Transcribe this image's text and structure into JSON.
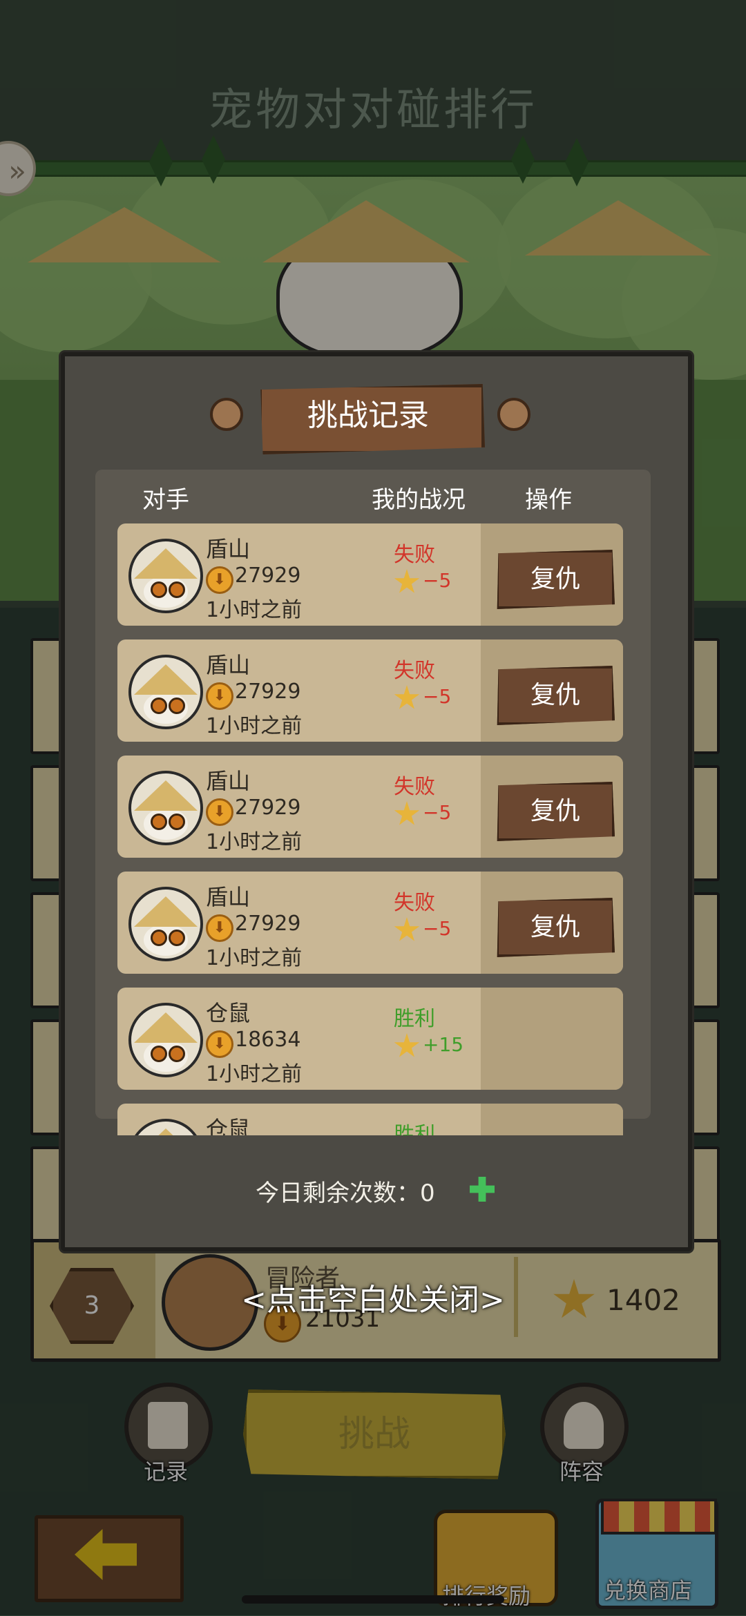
{
  "page": {
    "title": "宠物对对碰排行"
  },
  "modal": {
    "title": "挑战记录",
    "columns": {
      "opponent": "对手",
      "my_record": "我的战况",
      "action": "操作"
    },
    "rows": [
      {
        "name": "盾山",
        "score": "27929",
        "time": "1小时之前",
        "result": "失败",
        "delta": "−5",
        "action": "复仇",
        "outcome": "lose"
      },
      {
        "name": "盾山",
        "score": "27929",
        "time": "1小时之前",
        "result": "失败",
        "delta": "−5",
        "action": "复仇",
        "outcome": "lose"
      },
      {
        "name": "盾山",
        "score": "27929",
        "time": "1小时之前",
        "result": "失败",
        "delta": "−5",
        "action": "复仇",
        "outcome": "lose"
      },
      {
        "name": "盾山",
        "score": "27929",
        "time": "1小时之前",
        "result": "失败",
        "delta": "−5",
        "action": "复仇",
        "outcome": "lose"
      },
      {
        "name": "仓鼠",
        "score": "18634",
        "time": "1小时之前",
        "result": "胜利",
        "delta": "+15",
        "action": "",
        "outcome": "win"
      },
      {
        "name": "仓鼠",
        "score": "",
        "time": "",
        "result": "胜利",
        "delta": "",
        "action": "",
        "outcome": "win"
      }
    ],
    "remaining_label": "今日剩余次数：0",
    "close_hint": "<点击空白处关闭>"
  },
  "player": {
    "rank": "3",
    "name": "冒险者",
    "score": "21031",
    "points": "1402"
  },
  "bottom": {
    "record_label": "记录",
    "challenge_label": "挑战",
    "lineup_label": "阵容",
    "rank_reward_label": "排行奖励",
    "shop_label": "兑换商店"
  },
  "icons": {
    "expand": "double-chevron-right-icon",
    "coin": "down-arrow-coin-icon",
    "star": "star-icon",
    "add": "plus-icon",
    "back": "left-arrow-icon"
  },
  "colors": {
    "lose": "#d2352a",
    "win": "#3f9e2a",
    "accent": "#c9b13a"
  }
}
